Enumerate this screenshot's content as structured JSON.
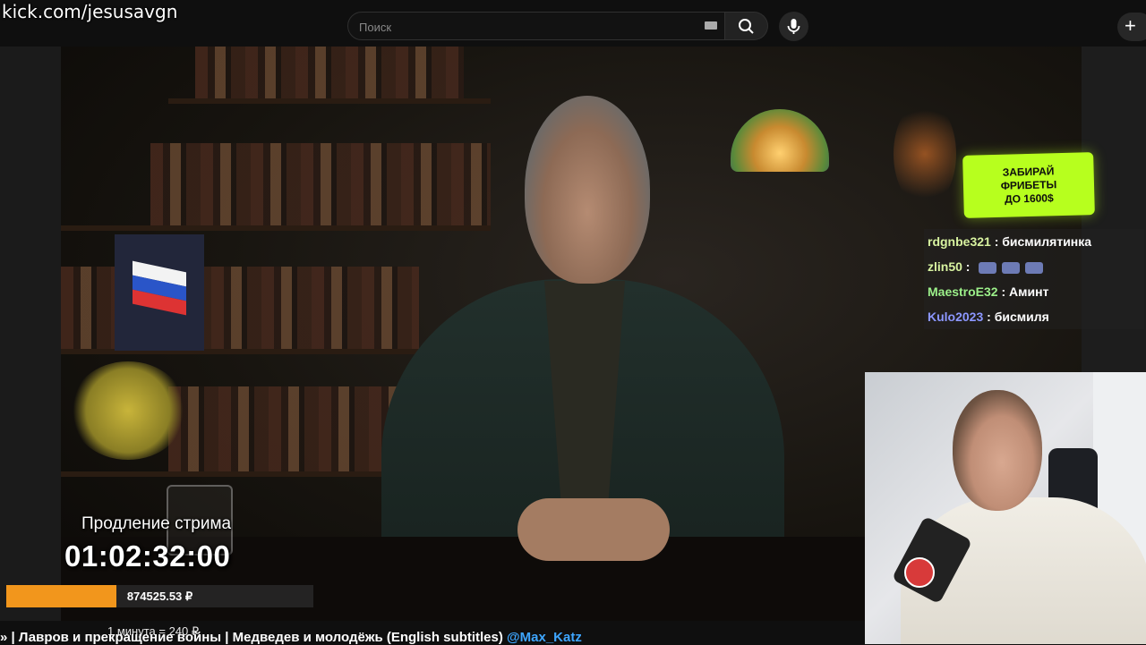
{
  "stream": {
    "url_text": "kick.com/jesusavgn"
  },
  "search": {
    "placeholder": "Поиск"
  },
  "overlay": {
    "extension_label": "Продление стрима",
    "timer": "01:02:32:00",
    "donation_total": "874525.53 ₽",
    "goal_progress_fraction": 0.36,
    "rate": "1 минута = 240 ₽",
    "progress_color": "#f2961c"
  },
  "video": {
    "title": "» | Лавров и прекращение войны | Медведев и молодёжь (English subtitles) ",
    "channel_mention": "@Max_Katz"
  },
  "promo": {
    "line1": "ЗАБИРАЙ",
    "line2": "ФРИБЕТЫ",
    "line3": "ДО 1600$",
    "color": "#b7ff1e"
  },
  "chat": {
    "messages": [
      {
        "user": "rdgnbe321",
        "sep": " : ",
        "text": "бисмилятинка",
        "color": "#d8f3a0"
      },
      {
        "user": "zlin50",
        "sep": " : ",
        "text": "",
        "emotes": 3,
        "color": "#d8f3a0"
      },
      {
        "user": "MaestroE32",
        "sep": " : ",
        "text": "Аминт",
        "color": "#9cf08a"
      },
      {
        "user": "Kulo2023",
        "sep": " : ",
        "text": "бисмиля",
        "color": "#8c97ff"
      }
    ]
  },
  "icons": {
    "search": "search-icon",
    "mic": "microphone-icon",
    "keyboard": "keyboard-icon",
    "create": "plus-icon"
  }
}
